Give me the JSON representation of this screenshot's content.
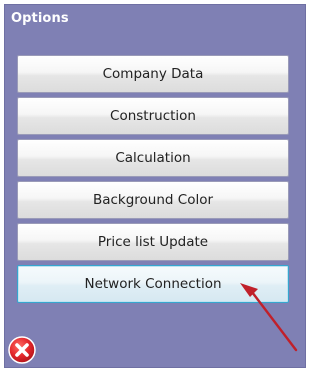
{
  "panel": {
    "title": "Options"
  },
  "buttons": [
    {
      "label": "Company Data"
    },
    {
      "label": "Construction"
    },
    {
      "label": "Calculation"
    },
    {
      "label": "Background Color"
    },
    {
      "label": "Price list Update"
    },
    {
      "label": "Network Connection",
      "selected": true
    }
  ],
  "icons": {
    "close": "close-icon",
    "annotation_arrow": "arrow-icon"
  },
  "colors": {
    "panel_bg": "#7f80b4",
    "selected_border": "#35a6cf",
    "arrow": "#c0202a",
    "close_red": "#e3262b"
  }
}
